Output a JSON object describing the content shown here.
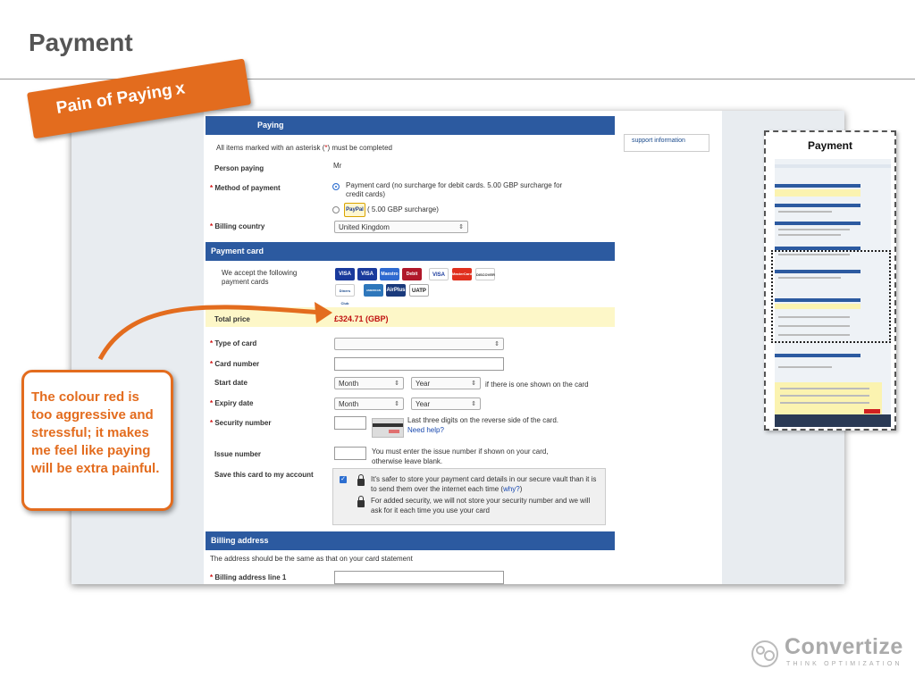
{
  "slide": {
    "title": "Payment"
  },
  "banner": {
    "label": "Pain of Paying",
    "mark": "x"
  },
  "callout": {
    "text": "The colour red is too aggressive and stressful; it makes me feel like paying will be extra painful."
  },
  "form": {
    "section_paying": "Paying",
    "asterisk_note_before": "All items marked with an asterisk (",
    "asterisk_symbol": "*",
    "asterisk_note_after": ") must be completed",
    "support_link": "support information",
    "person_paying": {
      "label": "Person paying",
      "value": "Mr"
    },
    "method": {
      "label": "Method of payment",
      "option_card": "Payment card (no surcharge for debit cards. 5.00 GBP surcharge for credit cards)",
      "paypal_logo": "PayPal",
      "option_paypal": "( 5.00 GBP surcharge)"
    },
    "billing_country": {
      "label": "Billing country",
      "value": "United Kingdom"
    },
    "section_card": "Payment card",
    "accept_text": "We accept the following payment cards",
    "card_logos": [
      "VISA",
      "VISA",
      "Maestro",
      "Debit",
      "VISA",
      "MasterCard",
      "DISCOVER",
      "Diners Club",
      "AMERICAN EXPRESS",
      "AirPlus",
      "UATP"
    ],
    "total": {
      "label": "Total price",
      "value": "£324.71 (GBP)",
      "color": "#c01010"
    },
    "type_of_card": {
      "label": "Type of card",
      "value": ""
    },
    "card_number": {
      "label": "Card number"
    },
    "start_date": {
      "label": "Start date",
      "month": "Month",
      "year": "Year",
      "hint": "if there is one shown on the card"
    },
    "expiry_date": {
      "label": "Expiry date",
      "month": "Month",
      "year": "Year"
    },
    "security_number": {
      "label": "Security number",
      "hint": "Last three digits on the reverse side of the card.",
      "help": "Need help?"
    },
    "issue_number": {
      "label": "Issue number",
      "hint": "You must enter the issue number if shown on your card, otherwise leave blank."
    },
    "save_card": {
      "label": "Save this card to my account",
      "text1": "It's safer to store your payment card details in our secure vault than it is to send them over the internet each time (",
      "why": "why?",
      "text1_end": ")",
      "text2": "For added security, we will not store your security number and we will ask for it each time you use your card"
    },
    "section_billing": "Billing address",
    "billing_note": "The address should be the same as that on your card statement",
    "billing_line1": {
      "label": "Billing address line 1"
    }
  },
  "thumbnail": {
    "title": "Payment"
  },
  "logo": {
    "name": "Convertize",
    "tagline": "THINK OPTIMIZATION"
  },
  "colors": {
    "accent": "#e36c1e",
    "header_blue": "#2c5aa0",
    "price_red": "#c01010"
  }
}
